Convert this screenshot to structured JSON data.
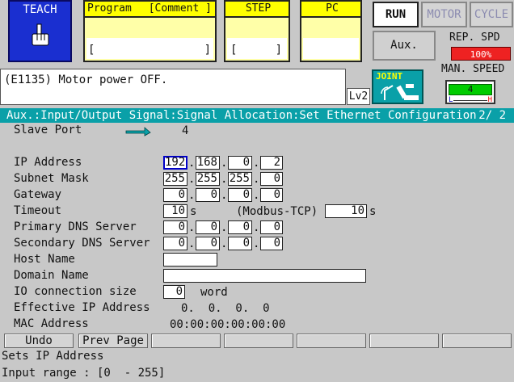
{
  "mode": {
    "teach_label": "TEACH"
  },
  "program_box": {
    "program_label": "Program",
    "comment_label": "[Comment ]",
    "bracket_open": "[",
    "bracket_close": "]"
  },
  "step_box": {
    "label": "STEP",
    "bracket_open": "[",
    "bracket_close": "]"
  },
  "pc_box": {
    "label": "PC"
  },
  "buttons": {
    "run": "RUN",
    "motor": "MOTOR",
    "cycle": "CYCLE",
    "aux": "Aux."
  },
  "speed": {
    "rep_label": "REP. SPD",
    "rep_value": "100%",
    "man_label": "MAN. SPEED",
    "man_value": "4",
    "man_low": "L",
    "man_high": "H"
  },
  "message": "(E1135) Motor power OFF.",
  "level": "Lv2",
  "joint_label": "JOINT",
  "title": {
    "path": "Aux.:Input/Output Signal:Signal Allocation:Set Ethernet Configuration",
    "page": "2/ 2"
  },
  "form": {
    "slave_port": {
      "label": "Slave Port",
      "value": "4"
    },
    "ip": {
      "label": "IP Address",
      "o1": "192",
      "o2": "168",
      "o3": "0",
      "o4": "2"
    },
    "subnet": {
      "label": "Subnet Mask",
      "o1": "255",
      "o2": "255",
      "o3": "255",
      "o4": "0"
    },
    "gateway": {
      "label": "Gateway",
      "o1": "0",
      "o2": "0",
      "o3": "0",
      "o4": "0"
    },
    "timeout": {
      "label": "Timeout",
      "value": "10",
      "unit": "s",
      "modbus_label": "(Modbus-TCP)",
      "modbus_value": "10",
      "modbus_unit": "s"
    },
    "dns1": {
      "label": "Primary DNS Server",
      "o1": "0",
      "o2": "0",
      "o3": "0",
      "o4": "0"
    },
    "dns2": {
      "label": "Secondary DNS Server",
      "o1": "0",
      "o2": "0",
      "o3": "0",
      "o4": "0"
    },
    "host": {
      "label": "Host Name",
      "value": ""
    },
    "domain": {
      "label": "Domain Name",
      "value": ""
    },
    "io_size": {
      "label": "IO connection size",
      "value": "0",
      "unit": "word"
    },
    "eff_ip": {
      "label": "Effective IP Address",
      "value": "0.  0.  0.  0"
    },
    "mac": {
      "label": "MAC Address",
      "value": "00:00:00:00:00:00"
    }
  },
  "fkeys": [
    "Undo",
    "Prev Page",
    "",
    "",
    "",
    "",
    ""
  ],
  "help": {
    "line1": "Sets IP Address",
    "line2": "Input range : [0  - 255]"
  }
}
